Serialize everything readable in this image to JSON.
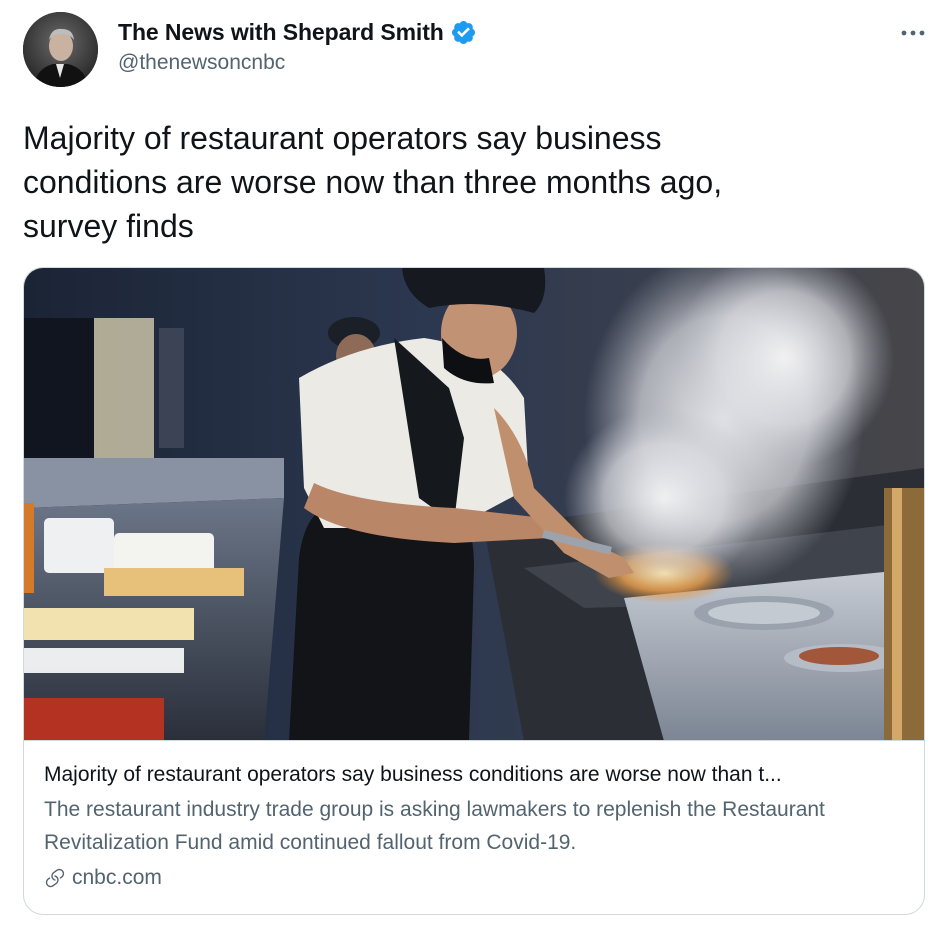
{
  "author": {
    "display_name": "The News with Shepard Smith",
    "handle": "@thenewsoncnbc",
    "verified": true,
    "avatar_icon": "avatar-photo"
  },
  "icons": {
    "verified": "verified-badge-icon",
    "more": "more-options-icon",
    "link": "link-icon"
  },
  "tweet": {
    "text": "Majority of restaurant operators say business\nconditions are worse now than three months ago,\nsurvey finds"
  },
  "card": {
    "image_subject": "chef-cooking-photo",
    "title": "Majority of restaurant operators say business conditions are worse now than t...",
    "description": "The restaurant industry trade group is asking lawmakers to replenish the Restaurant Revitalization Fund amid continued fallout from Covid-19.",
    "domain": "cnbc.com"
  },
  "colors": {
    "text_primary": "#0f1419",
    "text_secondary": "#536471",
    "verified_blue": "#1d9bf0",
    "border": "#cfd9de"
  }
}
